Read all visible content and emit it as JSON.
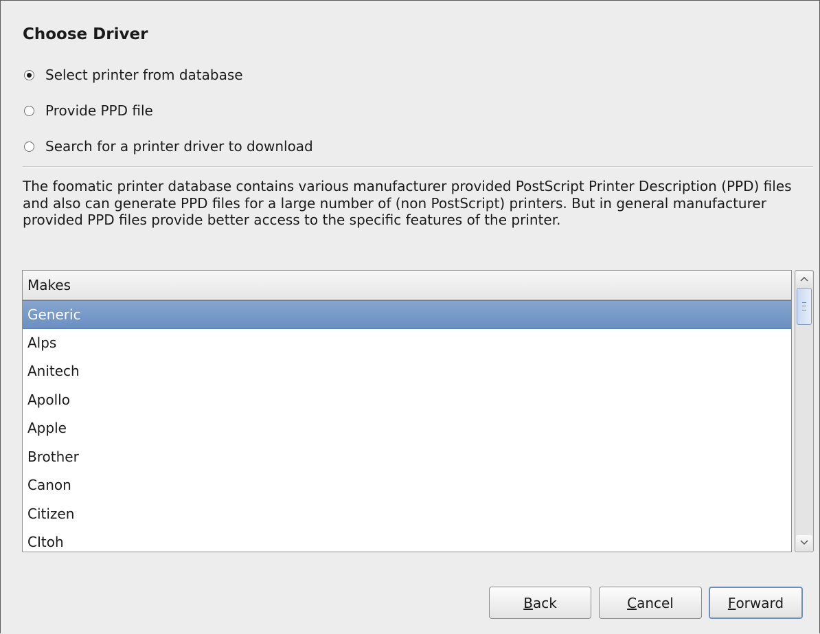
{
  "dialog": {
    "title": "Choose Driver"
  },
  "options": [
    {
      "label": "Select printer from database",
      "selected": true
    },
    {
      "label": "Provide PPD file",
      "selected": false
    },
    {
      "label": "Search for a printer driver to download",
      "selected": false
    }
  ],
  "description": "The foomatic printer database contains various manufacturer provided PostScript Printer Description (PPD) files and also can generate PPD files for a large number of (non PostScript) printers. But in general manufacturer provided PPD files provide better access to the specific features of the printer.",
  "makes_list": {
    "header": "Makes",
    "selected_index": 0,
    "items": [
      "Generic",
      "Alps",
      "Anitech",
      "Apollo",
      "Apple",
      "Brother",
      "Canon",
      "Citizen",
      "CItoh"
    ]
  },
  "buttons": {
    "back": {
      "mnemonic": "B",
      "rest": "ack"
    },
    "cancel": {
      "mnemonic": "C",
      "rest": "ancel"
    },
    "forward": {
      "mnemonic": "F",
      "rest": "orward"
    }
  },
  "colors": {
    "selection": "#6a8fc2",
    "window_bg": "#ededed"
  }
}
